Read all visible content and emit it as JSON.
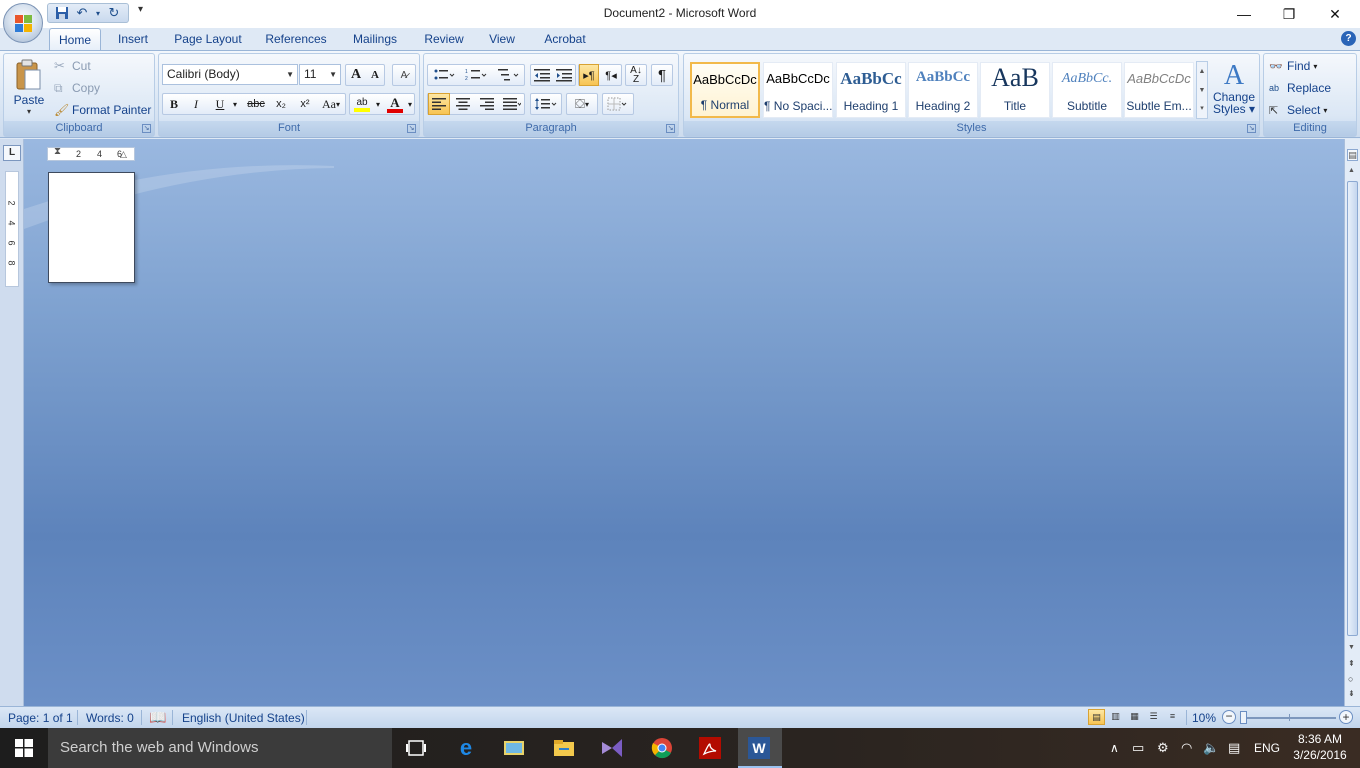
{
  "window": {
    "title": "Document2 - Microsoft Word",
    "minimize": "—",
    "restore": "❐",
    "close": "✕"
  },
  "tabs": [
    "Home",
    "Insert",
    "Page Layout",
    "References",
    "Mailings",
    "Review",
    "View",
    "Acrobat"
  ],
  "help": "?",
  "clipboard": {
    "label": "Clipboard",
    "paste": "Paste",
    "cut": "Cut",
    "copy": "Copy",
    "format_painter": "Format Painter"
  },
  "font": {
    "label": "Font",
    "family": "Calibri (Body)",
    "size": "11",
    "grow": "A",
    "shrink": "A",
    "bold": "B",
    "italic": "I",
    "underline": "U",
    "strike": "abc",
    "subscript": "x₂",
    "superscript": "x²",
    "change_case": "Aa",
    "highlight": "ab",
    "font_color": "A"
  },
  "paragraph": {
    "label": "Paragraph",
    "show_marks": "¶"
  },
  "styles": {
    "label": "Styles",
    "items": [
      {
        "preview": "AaBbCcDc",
        "name": "¶ Normal"
      },
      {
        "preview": "AaBbCcDc",
        "name": "¶ No Spaci..."
      },
      {
        "preview": "AaBbCc",
        "name": "Heading 1"
      },
      {
        "preview": "AaBbCc",
        "name": "Heading 2"
      },
      {
        "preview": "AaB",
        "name": "Title"
      },
      {
        "preview": "AaBbCc.",
        "name": "Subtitle"
      },
      {
        "preview": "AaBbCcDc",
        "name": "Subtle Em..."
      }
    ],
    "change_styles_line1": "Change",
    "change_styles_line2": "Styles"
  },
  "editing": {
    "label": "Editing",
    "find": "Find",
    "replace": "Replace",
    "select": "Select"
  },
  "rulers": {
    "tab_selector": "L",
    "h_marks": [
      "2",
      "4",
      "6"
    ],
    "v_marks": [
      "2",
      "4",
      "6",
      "8"
    ]
  },
  "status": {
    "page": "Page: 1 of 1",
    "words": "Words: 0",
    "language": "English (United States)",
    "zoom": "10%"
  },
  "taskbar": {
    "search_placeholder": "Search the web and Windows",
    "language": "ENG",
    "time": "8:36 AM",
    "date": "3/26/2016"
  },
  "colors": {
    "ribbon_text": "#15428b",
    "highlight": "#ffff00",
    "font_color": "#e00000",
    "taskbar": "#1d1d1d"
  }
}
